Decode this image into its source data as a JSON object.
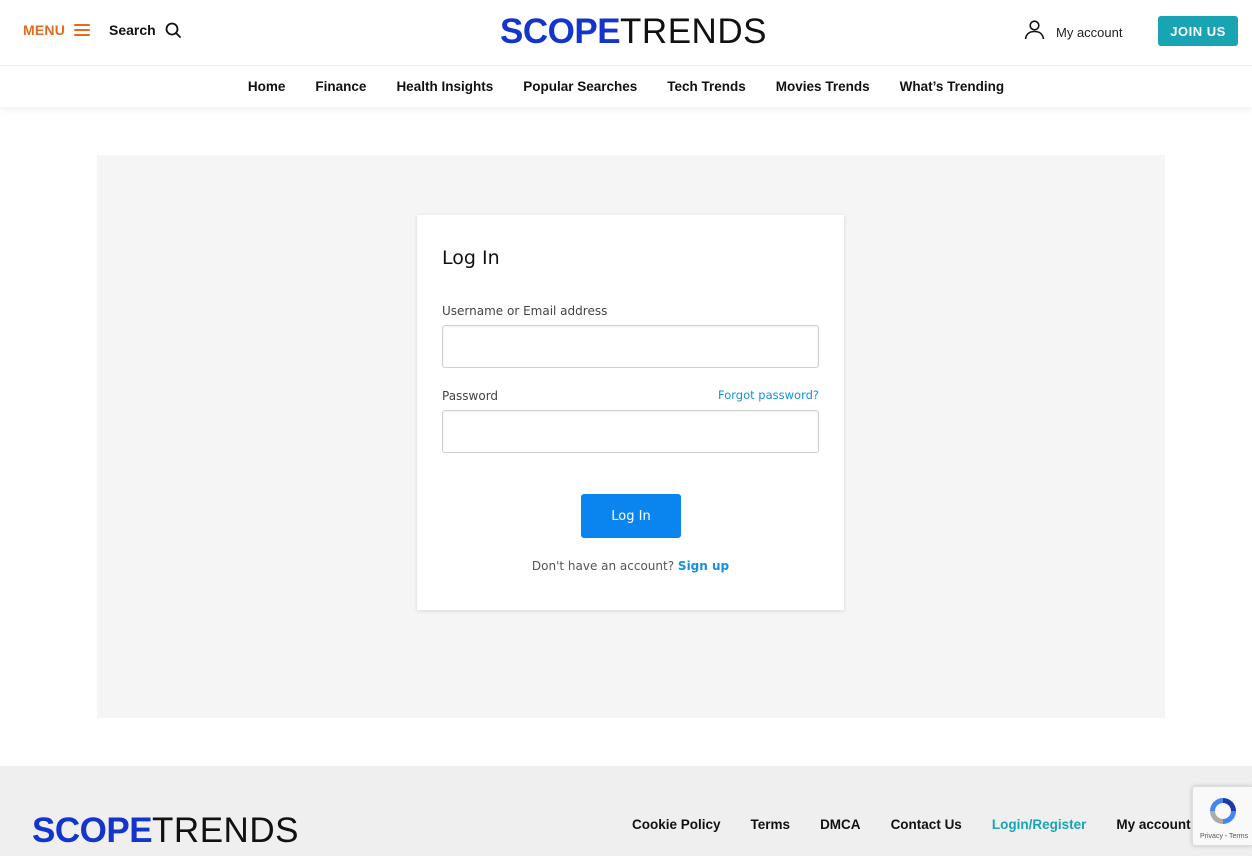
{
  "header": {
    "menu_label": "MENU",
    "search_label": "Search",
    "logo_part1": "SCOPE",
    "logo_part2": "TRENDS",
    "account_label": "My account",
    "join_label": "JOIN US"
  },
  "nav": {
    "items": [
      "Home",
      "Finance",
      "Health Insights",
      "Popular Searches",
      "Tech Trends",
      "Movies Trends",
      "What’s Trending"
    ]
  },
  "login": {
    "title": "Log In",
    "username_label": "Username or Email address",
    "username_value": "",
    "password_label": "Password",
    "password_value": "",
    "forgot_label": "Forgot password?",
    "button_label": "Log In",
    "no_account_text": "Don't have an account?",
    "signup_label": "Sign up"
  },
  "footer": {
    "logo_part1": "SCOPE",
    "logo_part2": "TRENDS",
    "links": [
      "Cookie Policy",
      "Terms",
      "DMCA",
      "Contact Us",
      "Login/Register",
      "My account"
    ]
  },
  "recaptcha": {
    "text": "Privacy - Terms"
  },
  "colors": {
    "brand_blue": "#1435cc",
    "accent_orange": "#e26b1f",
    "teal": "#19a4b4",
    "link_blue": "#1590e0",
    "button_blue": "#0a85f0"
  },
  "icons": {
    "menu": "hamburger-icon",
    "search": "search-icon",
    "account": "user-icon",
    "recaptcha": "recaptcha-icon"
  }
}
